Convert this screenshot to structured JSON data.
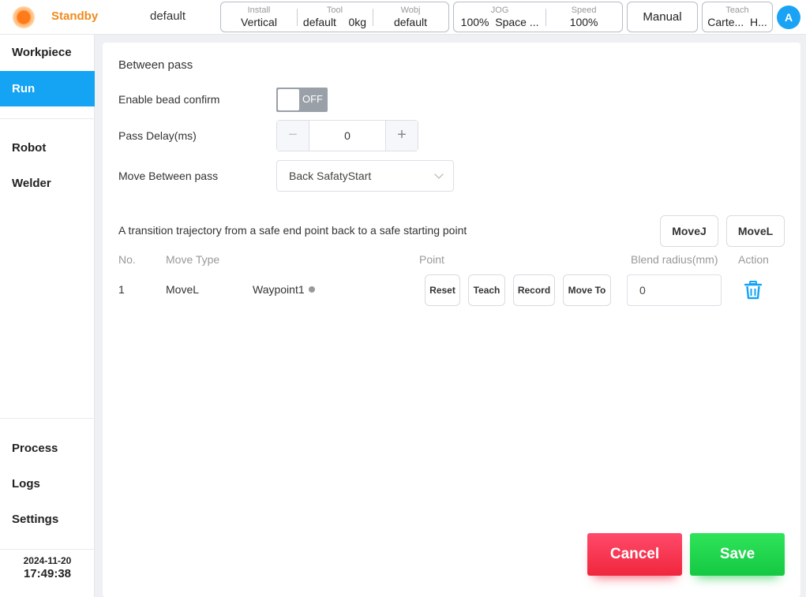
{
  "header": {
    "status": "Standby",
    "project": "default",
    "install": {
      "label": "Install",
      "value": "Vertical"
    },
    "tool": {
      "label": "Tool",
      "value": "default",
      "load": "0kg"
    },
    "wobj": {
      "label": "Wobj",
      "value": "default"
    },
    "jog": {
      "label": "JOG",
      "value": "100%",
      "mode": "Space ..."
    },
    "speed": {
      "label": "Speed",
      "value": "100%"
    },
    "manual_label": "Manual",
    "teach": {
      "label": "Teach",
      "value": "Carte...",
      "value2": "H..."
    },
    "avatar_letter": "A"
  },
  "sidebar": {
    "items": [
      {
        "label": "Workpiece"
      },
      {
        "label": "Run"
      },
      {
        "label": "Robot"
      },
      {
        "label": "Welder"
      },
      {
        "label": "Process"
      },
      {
        "label": "Logs"
      },
      {
        "label": "Settings"
      }
    ],
    "active": "Run",
    "date": "2024-11-20",
    "time": "17:49:38"
  },
  "form": {
    "title": "Between pass",
    "bead_confirm": {
      "label": "Enable bead confirm",
      "state": "OFF"
    },
    "pass_delay": {
      "label": "Pass Delay(ms)",
      "value": "0",
      "minus": "−",
      "plus": "+"
    },
    "move_between": {
      "label": "Move Between pass",
      "value": "Back SafatyStart"
    },
    "description": "A transition trajectory from a safe end point back to a safe starting point",
    "movej_label": "MoveJ",
    "movel_label": "MoveL"
  },
  "table": {
    "headers": {
      "no": "No.",
      "move_type": "Move Type",
      "point": "Point",
      "blend": "Blend radius(mm)",
      "action": "Action"
    },
    "rows": [
      {
        "no": "1",
        "move_type": "MoveL",
        "waypoint": "Waypoint1",
        "reset": "Reset",
        "teach": "Teach",
        "record": "Record",
        "move_to": "Move To",
        "blend": "0"
      }
    ]
  },
  "footer": {
    "cancel_label": "Cancel",
    "save_label": "Save"
  },
  "colors": {
    "accent": "#15a3f4",
    "status": "#f08a1c",
    "cancel": "#f0263d",
    "save": "#15c842"
  }
}
